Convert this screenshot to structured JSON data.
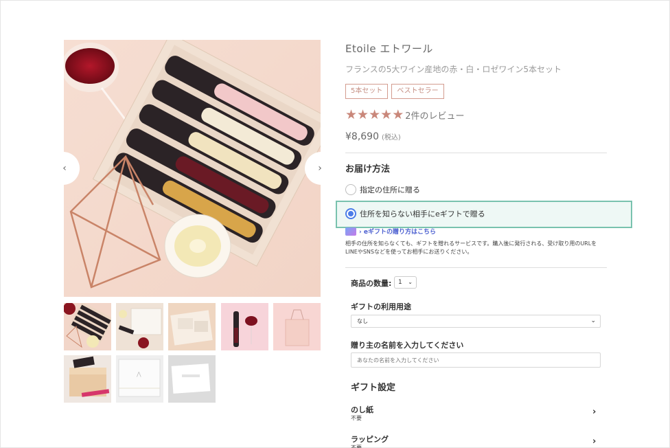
{
  "gallery": {
    "prev_icon": "chevron-left-icon",
    "next_icon": "chevron-right-icon",
    "prev_glyph": "‹",
    "next_glyph": "›"
  },
  "product": {
    "title": "Etoile エトワール",
    "subtitle": "フランスの5大ワイン産地の赤・白・ロゼワイン5本セット",
    "tags": [
      "5本セット",
      "ベストセラー"
    ],
    "rating_stars": 5,
    "rating_text": "2件のレビュー",
    "price": "¥8,690",
    "tax_label": "(税込)"
  },
  "delivery": {
    "heading": "お届け方法",
    "options": [
      {
        "label": "指定の住所に贈る",
        "selected": false
      },
      {
        "label": "住所を知らない相手にeギフトで贈る",
        "selected": true
      }
    ],
    "egift_link": "› eギフトの贈り方はこちら",
    "description": "相手の住所を知らなくても、ギフトを贈れるサービスです。購入後に発行される、受け取り用のURLをLINEやSNSなどを使ってお相手にお送りください。"
  },
  "form": {
    "quantity_label": "商品の数量:",
    "quantity_value": "1",
    "usage_label": "ギフトの利用用途",
    "usage_value": "なし",
    "sender_label": "贈り主の名前を入力してください",
    "sender_placeholder": "あなたの名前を入力してください"
  },
  "gift_settings": {
    "heading": "ギフト設定",
    "rows": [
      {
        "title": "のし紙",
        "value": "不要"
      },
      {
        "title": "ラッピング",
        "value": "不要"
      }
    ]
  },
  "colors": {
    "accent_star": "#c9877a",
    "highlight_border": "#79c2ae",
    "radio_selected": "#4d7de8"
  }
}
